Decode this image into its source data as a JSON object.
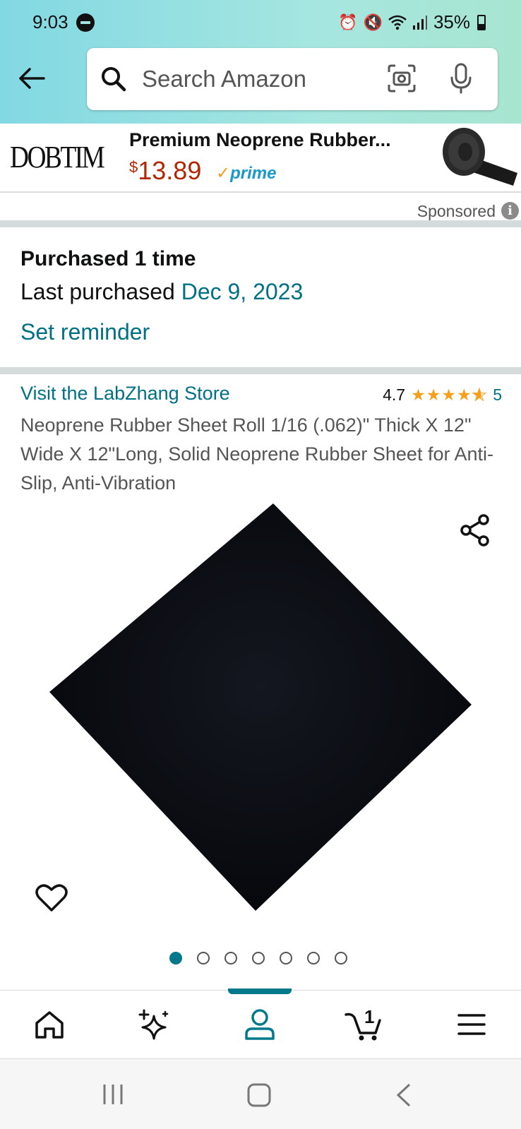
{
  "status_bar": {
    "time": "9:03",
    "battery": "35%"
  },
  "search": {
    "placeholder": "Search Amazon"
  },
  "ad": {
    "brand": "DOBTIM",
    "title": "Premium Neoprene Rubber...",
    "price_symbol": "$",
    "price": "13.89",
    "prime": "prime",
    "sponsored_label": "Sponsored"
  },
  "purchase": {
    "purchased_times": "Purchased 1 time",
    "last_purchased_label": "Last purchased ",
    "last_purchased_date": "Dec 9, 2023",
    "reminder_label": "Set reminder"
  },
  "product": {
    "store_link": "Visit the LabZhang Store",
    "rating": "4.7",
    "stars": 4.7,
    "review_count": "5",
    "title": "Neoprene Rubber Sheet Roll 1/16 (.062)\" Thick X 12\" Wide X 12\"Long, Solid Neoprene Rubber Sheet for Anti-Slip, Anti-Vibration",
    "image_count": 7,
    "active_image": 1
  },
  "bottom_nav": {
    "items": [
      "home-icon",
      "sparkle-icon",
      "account-icon",
      "cart-icon",
      "menu-icon"
    ],
    "cart_count": "1",
    "active": "account-icon"
  },
  "colors": {
    "link": "#007185",
    "price": "#b12704",
    "star": "#f59f1b",
    "active_accent": "#00798c"
  }
}
